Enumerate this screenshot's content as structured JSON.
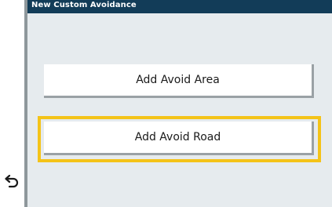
{
  "title": "New Custom Avoidance",
  "options": [
    {
      "label": "Add Avoid Area",
      "selected": false
    },
    {
      "label": "Add Avoid Road",
      "selected": true
    }
  ],
  "back": {
    "icon": "back-arrow-icon"
  },
  "colors": {
    "titlebar": "#123c58",
    "background": "#e6ebee",
    "focus": "#f4c318",
    "button_shadow": "#9aa1a5"
  }
}
